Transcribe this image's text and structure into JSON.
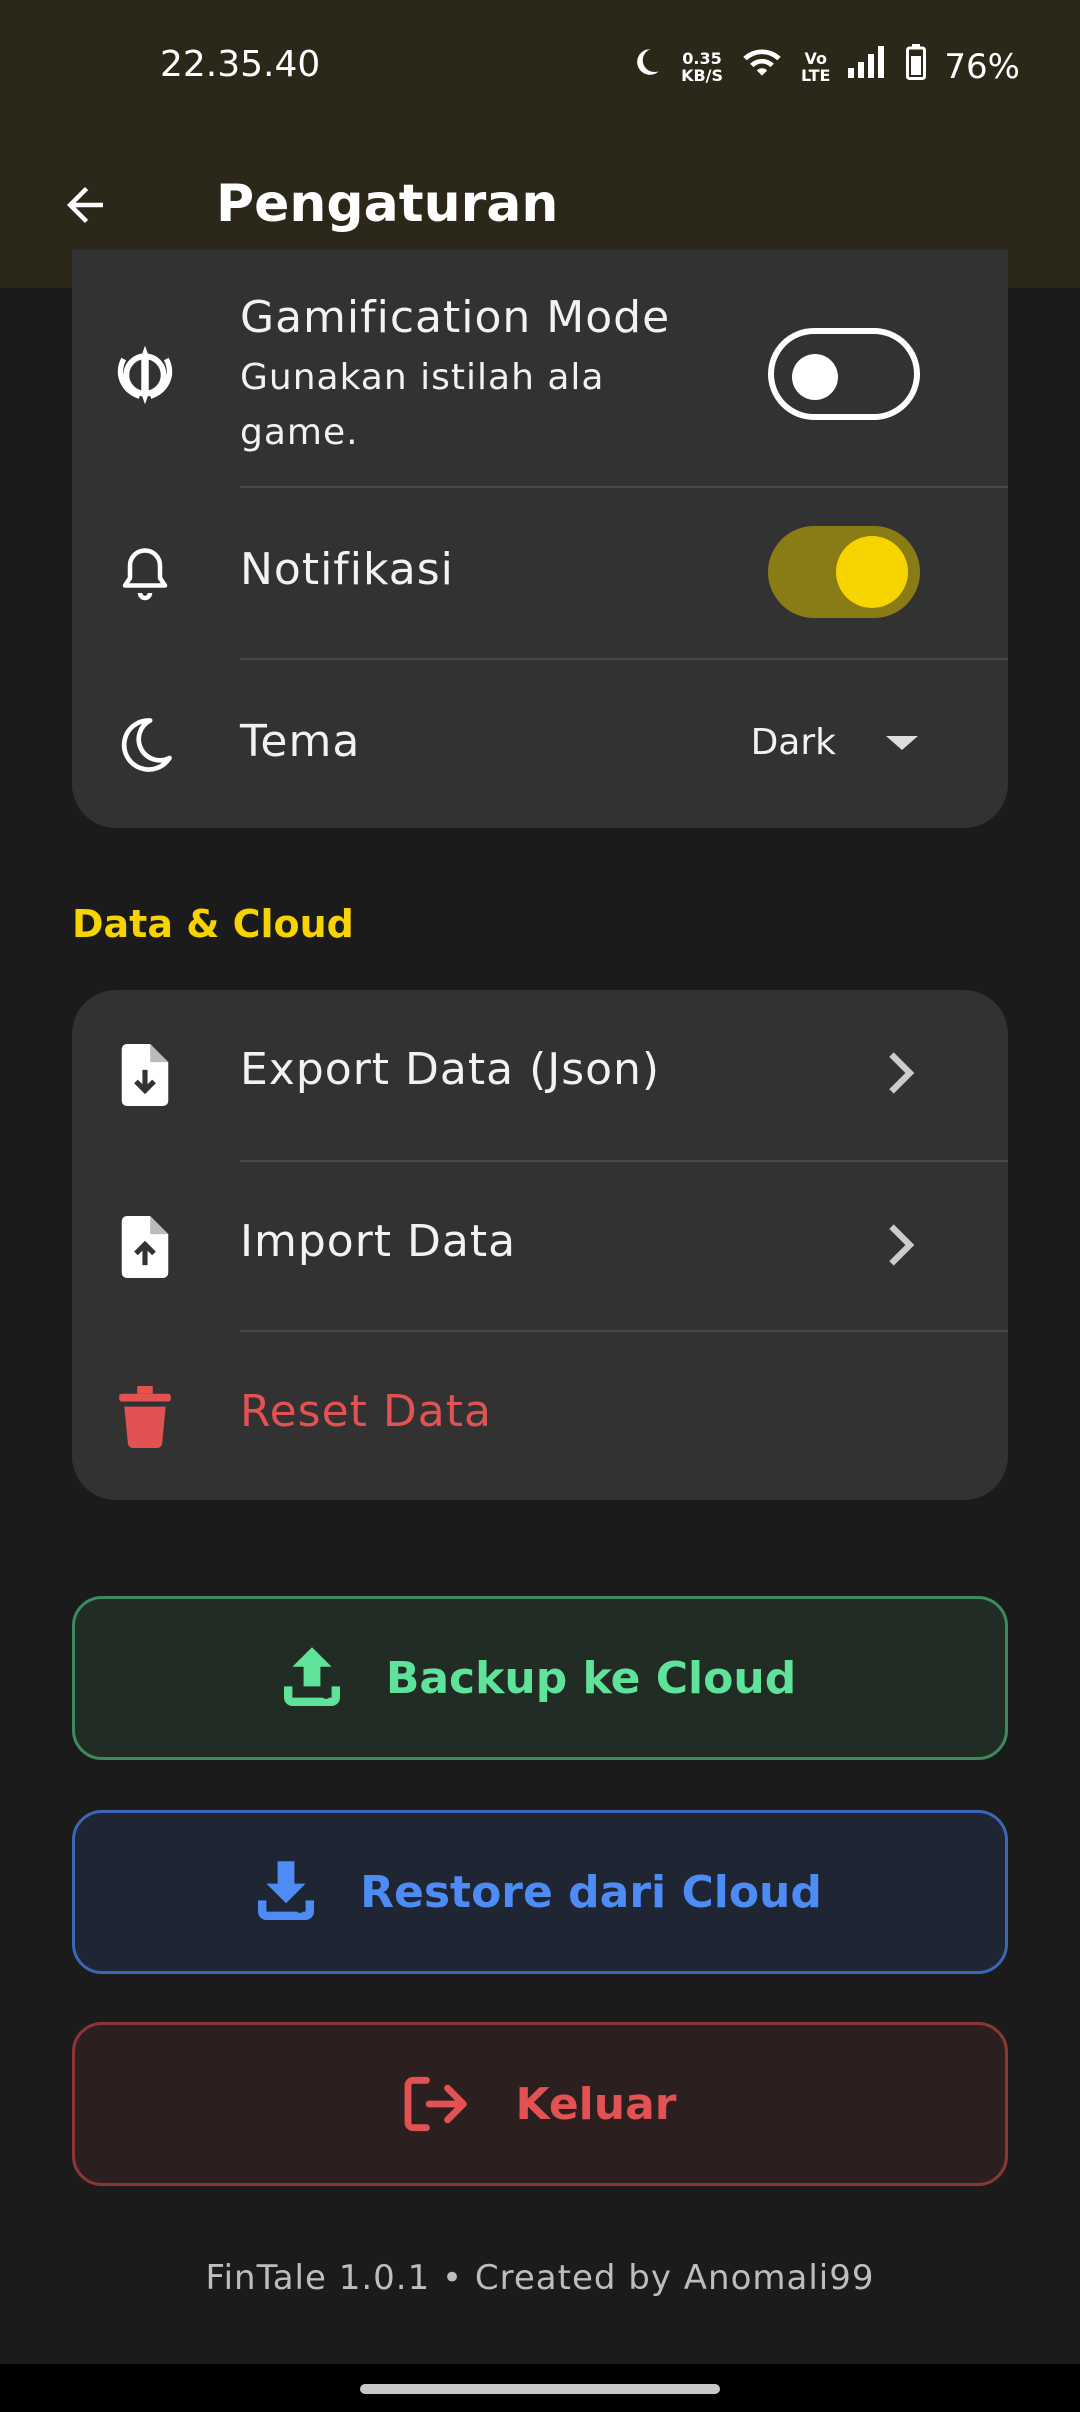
{
  "status": {
    "time": "22.35.40",
    "net_speed_value": "0.35",
    "net_speed_unit": "KB/S",
    "volte_top": "Vo",
    "volte_bottom": "LTE",
    "battery": "76%"
  },
  "appbar": {
    "title": "Pengaturan"
  },
  "preferences": {
    "gamification": {
      "label": "Gamification Mode",
      "description": "Gunakan istilah ala game.",
      "enabled": false
    },
    "notifications": {
      "label": "Notifikasi",
      "enabled": true
    },
    "theme": {
      "label": "Tema",
      "value": "Dark"
    }
  },
  "data_section": {
    "title": "Data & Cloud",
    "items": [
      {
        "label": "Export Data (Json)"
      },
      {
        "label": "Import Data"
      },
      {
        "label": "Reset Data"
      }
    ]
  },
  "actions": {
    "backup": "Backup ke Cloud",
    "restore": "Restore dari Cloud",
    "logout": "Keluar"
  },
  "footer": {
    "text": "FinTale 1.0.1  •  Created by Anomali99"
  },
  "colors": {
    "accent": "#f7d300",
    "backup": "#5fe39a",
    "restore": "#4d8cf5",
    "danger": "#e35252"
  }
}
